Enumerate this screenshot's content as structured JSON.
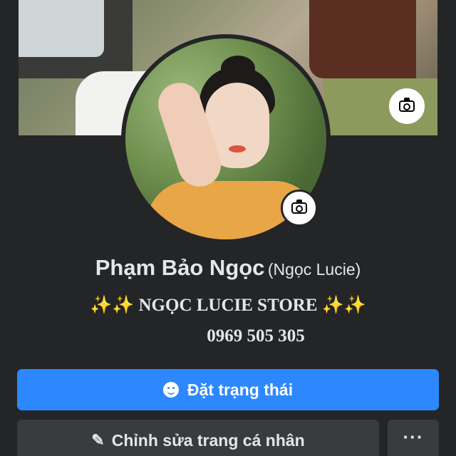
{
  "profile": {
    "name": "Phạm Bảo Ngọc",
    "alternate_name": "(Ngọc Lucie)",
    "bio_line1_sparkles_left": "✨✨",
    "bio_line1_text": "NGỌC LUCIE STORE",
    "bio_line1_sparkles_right": "✨✨",
    "bio_line2": "0969 505 305"
  },
  "actions": {
    "status_label": "Đặt trạng thái",
    "edit_label": "Chỉnh sửa trang cá nhân",
    "more_label": "···"
  },
  "icons": {
    "cover_camera": "camera-icon",
    "avatar_camera": "camera-icon",
    "status": "smile-icon",
    "edit": "pencil-icon",
    "more": "more-dots-icon"
  },
  "colors": {
    "background": "#242526",
    "primary_button": "#2d88ff",
    "secondary_button": "#3a3b3c",
    "text": "#e4e6eb"
  }
}
